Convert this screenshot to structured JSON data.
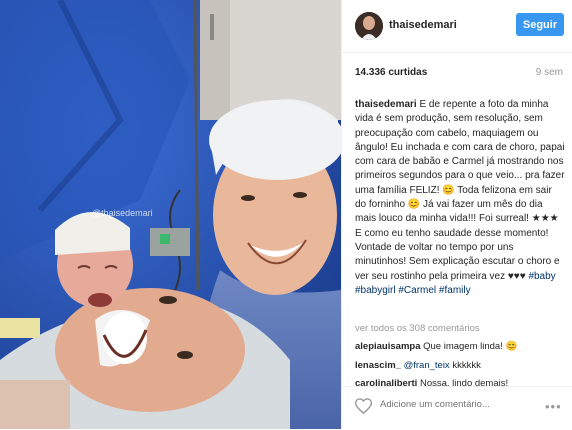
{
  "header": {
    "username": "thaisedemari",
    "follow_label": "Seguir"
  },
  "photo": {
    "watermark": "@thaisedemari"
  },
  "stats": {
    "likes": "14.336 curtidas",
    "time": "9 sem"
  },
  "caption": {
    "username": "thaisedemari",
    "text": " E de repente a foto da minha vida é sem produção, sem resolução, sem preocupação com cabelo, maquiagem ou ângulo! Eu inchada e com cara de choro, papai com cara de babão e Carmel já mostrando nos primeiros segundos para o que veio... pra fazer uma família FELIZ! 😊 Toda felizona em sair do forninho 😊 Já vai fazer um mês do dia mais louco da minha vida!!! Foi surreal! ★★★ E como eu tenho saudade desse momento! Vontade de voltar no tempo por uns minutinhos! Sem explicação escutar o choro e ver seu rostinho pela primeira vez ♥♥♥ ",
    "hashtags": "#baby #babygirl #Carmel #family"
  },
  "comments": {
    "view_all": "ver todos os 308 comentários",
    "items": [
      {
        "user": "alepiauisampa",
        "text": " Que imagem linda! 😊"
      },
      {
        "user": "lenascim_",
        "mention": " @fran_teix",
        "text": " kkkkkk"
      },
      {
        "user": "carolinaliberti",
        "text": " Nossa, lindo demais!"
      }
    ]
  },
  "comment_input": {
    "placeholder": "Adicione um comentário..."
  },
  "more_label": "•••",
  "colors": {
    "follow_button": "#3897f0",
    "link": "#003569",
    "muted": "#999999",
    "border": "#efefef",
    "surgical_drape": "#2e58b8"
  },
  "icons": [
    "heart-icon",
    "more-options-icon"
  ]
}
